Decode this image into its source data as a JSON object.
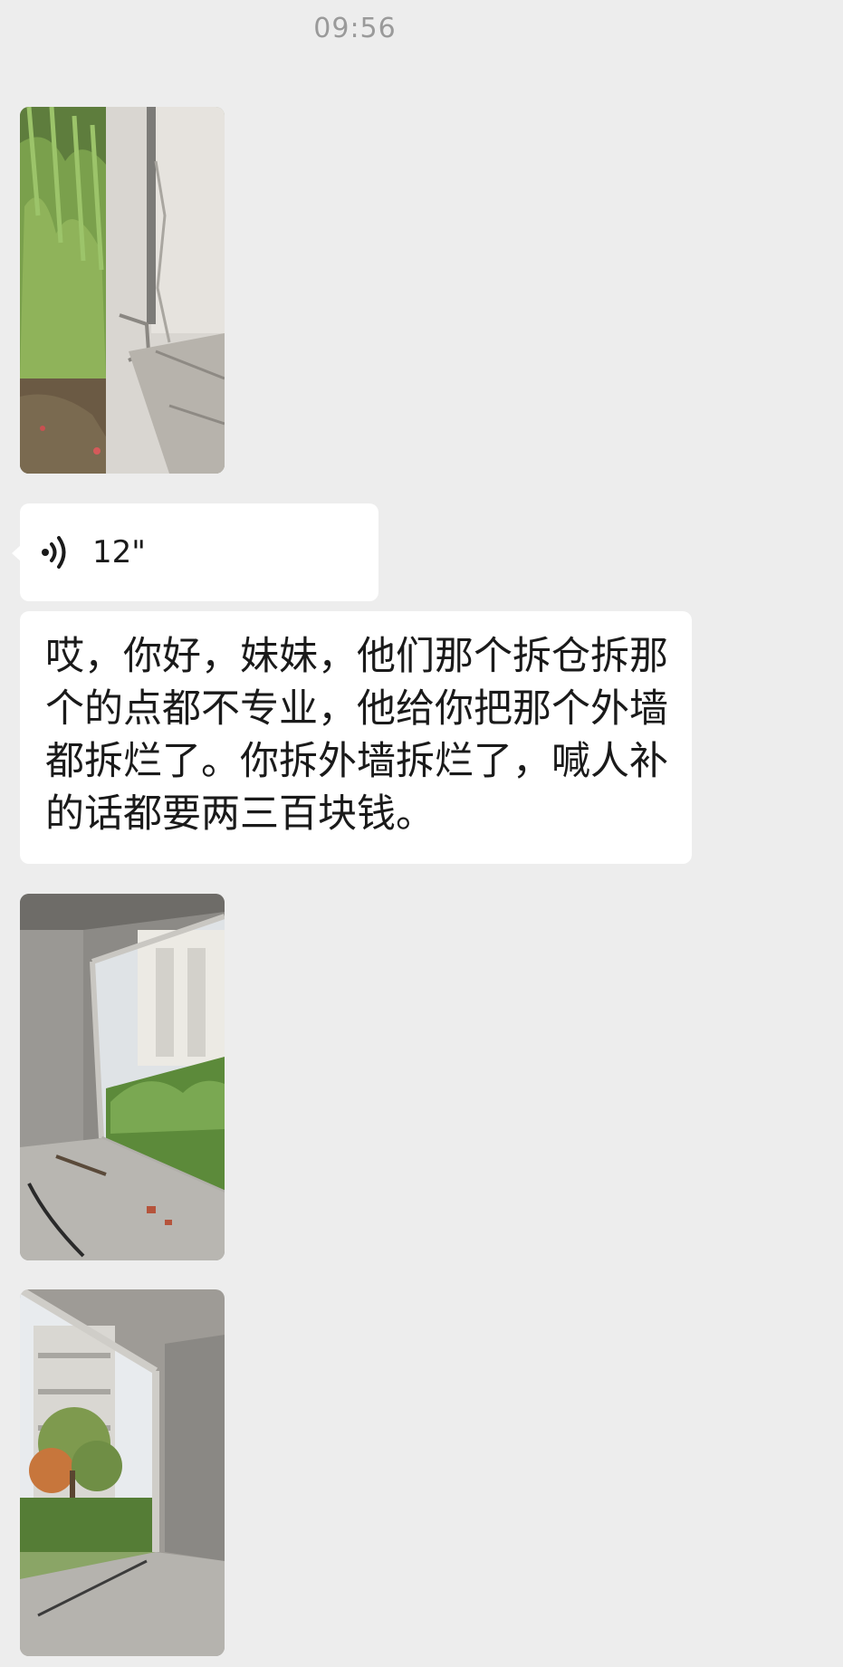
{
  "chat": {
    "timestamp": "09:56",
    "messages": [
      {
        "type": "image",
        "alt_icon": "photo-cracked-exterior-wall"
      },
      {
        "type": "voice",
        "duration": "12\"",
        "icon": "voice-wave-icon"
      },
      {
        "type": "text",
        "content": "哎，你好，妹妹，他们那个拆仓拆那个的点都不专业，他给你把那个外墙都拆烂了。你拆外墙拆烂了，喊人补的话都要两三百块钱。"
      },
      {
        "type": "image",
        "alt_icon": "photo-broken-window-frame-interior"
      },
      {
        "type": "image",
        "alt_icon": "photo-window-frame-with-garden-view"
      }
    ]
  },
  "colors": {
    "background": "#ededed",
    "bubble": "#ffffff",
    "timestamp_text": "#9a9a9a",
    "message_text": "#1a1a1a"
  }
}
